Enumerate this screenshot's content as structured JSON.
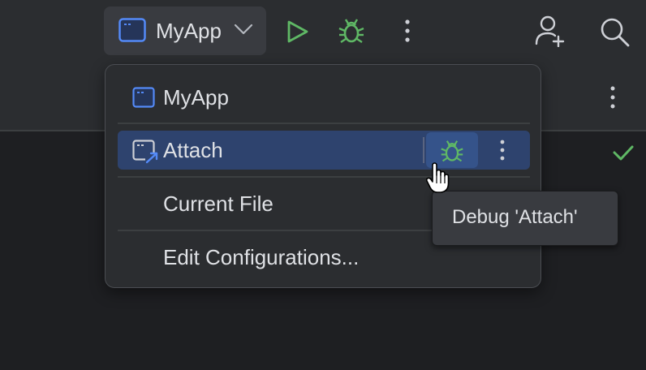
{
  "toolbar": {
    "run_config": {
      "label": "MyApp",
      "icon": "app-window-icon"
    },
    "actions": [
      {
        "name": "run",
        "icon": "run-icon",
        "color": "#5fb865"
      },
      {
        "name": "debug",
        "icon": "debug-bug-icon",
        "color": "#5fb865"
      },
      {
        "name": "more",
        "icon": "kebab-icon"
      },
      {
        "name": "add-user",
        "icon": "add-user-icon"
      },
      {
        "name": "search",
        "icon": "search-icon"
      }
    ]
  },
  "popup": {
    "items": [
      {
        "label": "MyApp",
        "icon": "app-window-icon",
        "selected": false
      },
      {
        "label": "Attach",
        "icon": "attach-window-icon",
        "selected": true
      },
      {
        "label": "Current File",
        "selected": false
      },
      {
        "label": "Edit Configurations...",
        "selected": false
      }
    ]
  },
  "tooltip": {
    "text": "Debug 'Attach'"
  },
  "colors": {
    "background": "#1e1f22",
    "toolbar": "#2b2d30",
    "selection": "#2e436e",
    "accent_blue": "#548af7",
    "run_green": "#5fb865",
    "text": "#dfe1e5"
  }
}
